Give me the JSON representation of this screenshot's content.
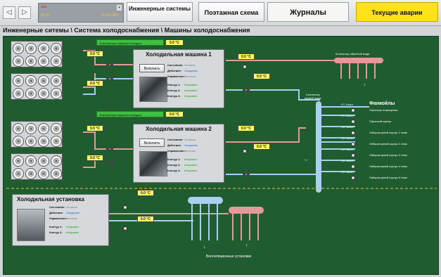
{
  "nav": {
    "back_icon": "arrow-left-icon",
    "fwd_icon": "arrow-right-icon"
  },
  "alarm_widget": {
    "line1": "ааа",
    "line2": "00:00",
    "line3": "00.00.0000",
    "dropdown_icon": "chevron-down-icon"
  },
  "tabs": {
    "engineering": "Инженерные системы",
    "floor": "Поэтажная схема",
    "journals": "Журналы",
    "alarms": "Текущие аварии"
  },
  "breadcrumb": "Инженерные ситемы \\ Система холодоснабжения \\ Машины холодоснабжения",
  "colors": {
    "main_bg": "#1f5c2f",
    "hot_pipe": "#e69999",
    "cold_pipe": "#a9d0ee",
    "alarm_tab": "#ffe21a",
    "temp_bg": "#ffff66"
  },
  "outdoor_temp_label": "Температура наружного воздуха",
  "machines": [
    {
      "title": "Холодильная машина 1",
      "button": "Включить",
      "rows": [
        {
          "k": "Состояние:",
          "v": "Останов"
        },
        {
          "k": "Действие:",
          "v": "Ожидание"
        },
        {
          "k": "Управление:",
          "v": "Местное"
        },
        {
          "k": "Контур 1:",
          "v": "Исправен"
        },
        {
          "k": "Контур 2:",
          "v": "Исправен"
        },
        {
          "k": "Контур 3:",
          "v": "Исправен"
        }
      ],
      "outdoor_temp": "0.0 °С"
    },
    {
      "title": "Холодильная машина 2",
      "button": "Включить",
      "rows": [
        {
          "k": "Состояние:",
          "v": "Останов"
        },
        {
          "k": "Действие:",
          "v": "Ожидание"
        },
        {
          "k": "Управление:",
          "v": "Местное"
        },
        {
          "k": "Контур 1:",
          "v": "Исправен"
        },
        {
          "k": "Контур 2:",
          "v": "Исправен"
        },
        {
          "k": "Контур 3:",
          "v": "Исправен"
        }
      ],
      "outdoor_temp": "0.0 °С"
    }
  ],
  "unit": {
    "title": "Холодильная установка",
    "rows": [
      {
        "k": "Состояние:",
        "v": "Останов"
      },
      {
        "k": "Действие:",
        "v": "Ожидание"
      },
      {
        "k": "Управление:",
        "v": "Местное"
      },
      {
        "k": "Контур 1:",
        "v": "Исправен"
      },
      {
        "k": "Контур 2:",
        "v": "Исправен"
      }
    ]
  },
  "temps": {
    "t": "0.0 °С"
  },
  "labels": {
    "return_collector": "Коллектор обратной воды",
    "supply_collector": "Коллектор прямой воды",
    "fancoils": "Фанкойлы",
    "vent": "Вентиляционные установки"
  },
  "fancoil_rows": [
    {
      "tag": "НТ. Выкл.",
      "name": "Офисные помещения"
    },
    {
      "tag": "НТ. Выкл.",
      "name": "Офисный корпус"
    },
    {
      "tag": "НК. Выкл.",
      "name": "Лабораторный корпус 1 этаж"
    },
    {
      "tag": "НК. Выкл.",
      "name": "Лабораторный корпус 2 этаж"
    },
    {
      "tag": "НК. Выкл.",
      "name": "Лабораторный корпус 3 этаж"
    },
    {
      "tag": "НК. Выкл.",
      "name": "Лабораторный корпус 4 этаж"
    },
    {
      "tag": "НК. Выкл.",
      "name": "Лабораторный корпус 5 этаж"
    }
  ]
}
